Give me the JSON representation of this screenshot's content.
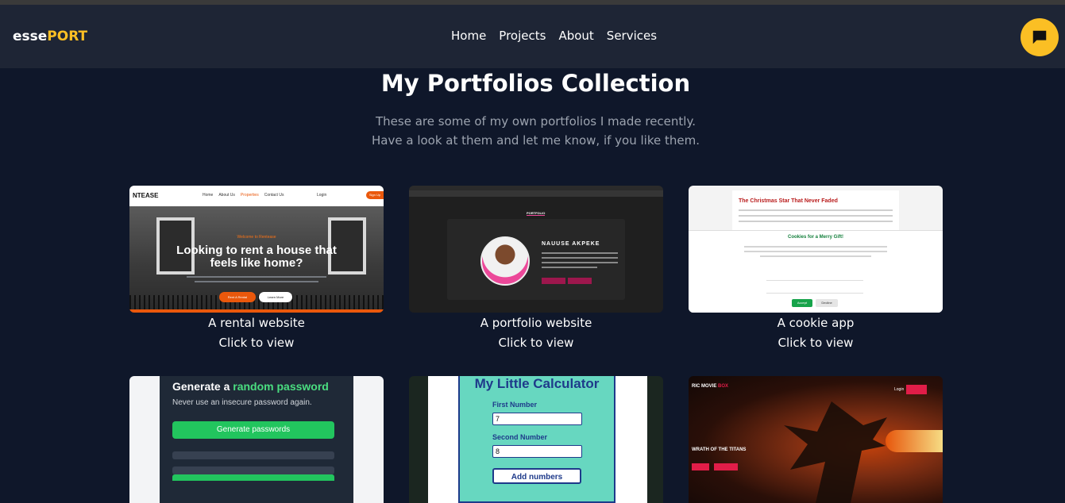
{
  "brand": {
    "part1": "esse",
    "part2": "PORT",
    "accent_color": "#fbbf24"
  },
  "nav": {
    "items": [
      "Home",
      "Projects",
      "About",
      "Services"
    ]
  },
  "chat": {
    "icon": "chat-bubble-icon"
  },
  "header": {
    "title": "My Portfolios Collection",
    "subtitle_line1": "These are some of my own portfolios I made recently.",
    "subtitle_line2": "Have a look at them and let me know, if you like them."
  },
  "projects": [
    {
      "caption": "A rental website",
      "cta": "Click to view",
      "thumb": {
        "logo": "NTEASE",
        "links": [
          "Home",
          "About Us",
          "Properties",
          "Contact Us"
        ],
        "login": "Login",
        "signup": "Sign Up",
        "welcome": "Welcome to Rentease",
        "headline1": "Looking to rent a house that",
        "headline2": "feels like home?",
        "btn1": "Rent A Rental",
        "btn2": "Learn More"
      }
    },
    {
      "caption": "A portfolio website",
      "cta": "Click to view",
      "thumb": {
        "tab": "PORTFOLIO",
        "name": "NAUUSE AKPEKE"
      }
    },
    {
      "caption": "A cookie app",
      "cta": "Click to view",
      "thumb": {
        "title": "The Christmas Star That Never Faded",
        "banner": "Cookies for a Merry Gift!",
        "accept": "Accept",
        "decline": "Decline"
      }
    },
    {
      "caption": "",
      "cta": "",
      "thumb": {
        "title_a": "Generate a ",
        "title_b": "random password",
        "desc": "Never use an insecure password again.",
        "btn": "Generate passwords"
      }
    },
    {
      "caption": "",
      "cta": "",
      "thumb": {
        "title": "My Little Calculator",
        "label1": "First Number",
        "value1": "7",
        "label2": "Second Number",
        "value2": "8",
        "btn": "Add numbers"
      }
    },
    {
      "caption": "",
      "cta": "",
      "thumb": {
        "logo_a": "RIC MOVIE ",
        "logo_b": "BOX",
        "login": "Login",
        "title": "WRATH OF THE TITANS"
      }
    }
  ]
}
